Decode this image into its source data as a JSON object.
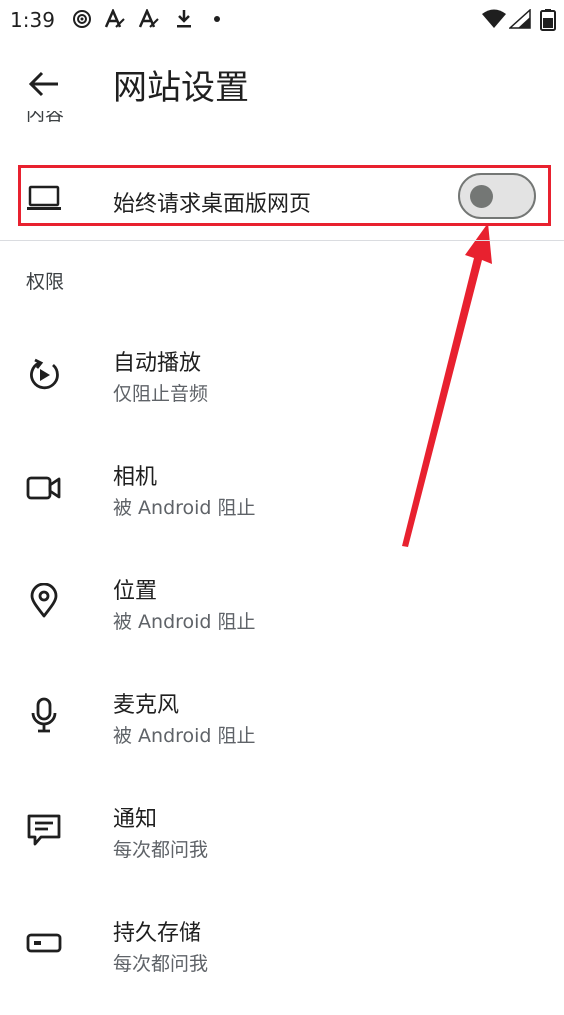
{
  "status_bar": {
    "time": "1:39",
    "icons": [
      "sync-icon",
      "text-a-icon",
      "text-a-icon",
      "download-icon",
      "dot-icon",
      "wifi-icon",
      "signal-icon",
      "battery-icon"
    ]
  },
  "app_bar": {
    "title": "网站设置",
    "back_icon": "arrow-back-icon"
  },
  "clipped_section_label": "内容",
  "desktop_site": {
    "label": "始终请求桌面版网页",
    "icon": "laptop-icon",
    "toggle_on": false
  },
  "permissions": {
    "header": "权限",
    "items": [
      {
        "title": "自动播放",
        "subtitle": "仅阻止音频",
        "icon": "autoplay-icon"
      },
      {
        "title": "相机",
        "subtitle": "被 Android 阻止",
        "icon": "videocam-icon"
      },
      {
        "title": "位置",
        "subtitle": "被 Android 阻止",
        "icon": "location-icon"
      },
      {
        "title": "麦克风",
        "subtitle": "被 Android 阻止",
        "icon": "mic-icon"
      },
      {
        "title": "通知",
        "subtitle": "每次都问我",
        "icon": "notification-icon"
      },
      {
        "title": "持久存储",
        "subtitle": "每次都问我",
        "icon": "storage-icon"
      }
    ]
  },
  "colors": {
    "highlight": "#e8212f",
    "toggle_track": "#e3e3e3",
    "toggle_outline": "#747775",
    "text_primary": "#1f1f1f",
    "text_secondary": "#5f6368"
  }
}
